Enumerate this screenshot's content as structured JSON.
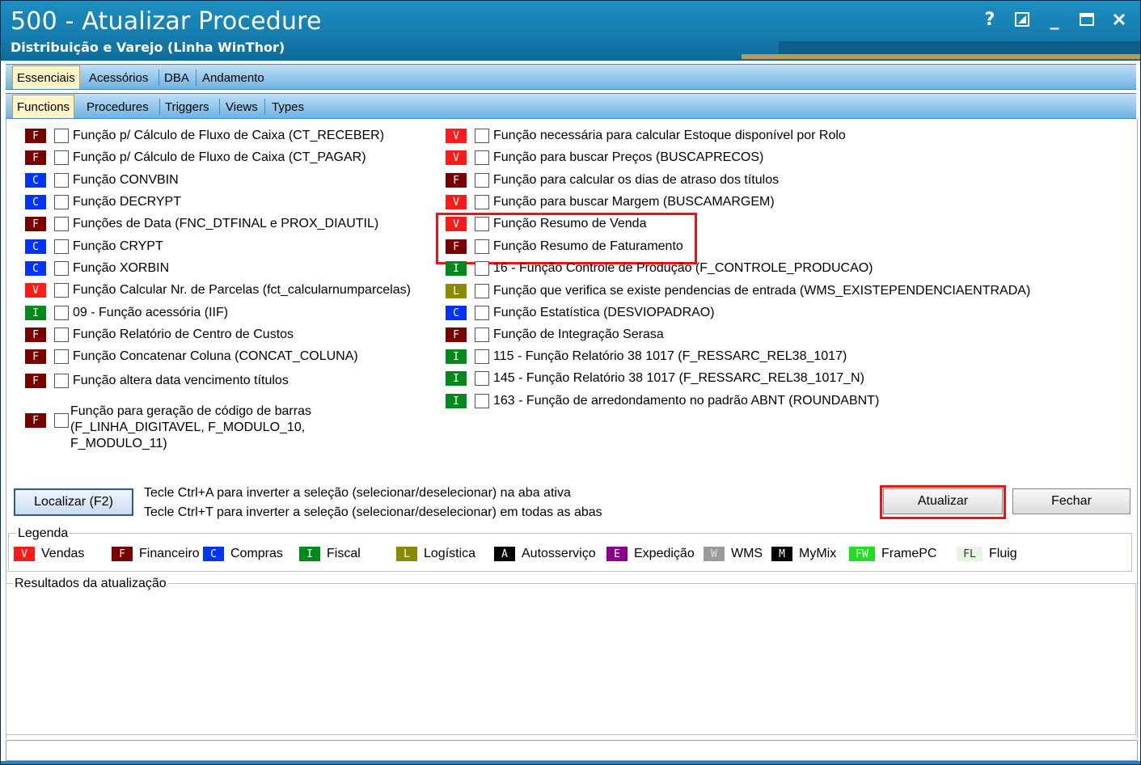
{
  "window": {
    "title": "500 - Atualizar Procedure",
    "subtitle": "Distribuição e Varejo (Linha WinThor)",
    "help_label": "?",
    "minimize_label": "_"
  },
  "tabs_main": [
    "Essenciais",
    "Acessórios",
    "DBA",
    "Andamento"
  ],
  "tabs_sub": [
    "Functions",
    "Procedures",
    "Triggers",
    "Views",
    "Types"
  ],
  "badge_colors": {
    "V": "#ff1a1a",
    "F": "#7a0000",
    "C": "#0033ff",
    "I": "#008a1c",
    "L": "#8a8a00",
    "A": "#000000",
    "E": "#8a008a",
    "W": "#9a9a9a",
    "M": "#000000",
    "FW": "#22dd22",
    "FL": "#e6f3e6"
  },
  "functions_left": [
    {
      "badge": "F",
      "label": "Função p/ Cálculo de Fluxo de Caixa (CT_RECEBER)"
    },
    {
      "badge": "F",
      "label": "Função p/ Cálculo de Fluxo de Caixa (CT_PAGAR)"
    },
    {
      "badge": "C",
      "label": "Função CONVBIN"
    },
    {
      "badge": "C",
      "label": "Função DECRYPT"
    },
    {
      "badge": "F",
      "label": "Funções de Data (FNC_DTFINAL e PROX_DIAUTIL)"
    },
    {
      "badge": "C",
      "label": "Função CRYPT"
    },
    {
      "badge": "C",
      "label": "Função XORBIN"
    },
    {
      "badge": "V",
      "label": "Função Calcular Nr. de Parcelas (fct_calcularnumparcelas)"
    },
    {
      "badge": "I",
      "label": "09 - Função acessória (IIF)"
    },
    {
      "badge": "F",
      "label": "Função Relatório de Centro de Custos"
    },
    {
      "badge": "F",
      "label": "Função Concatenar Coluna (CONCAT_COLUNA)"
    },
    {
      "badge": "F",
      "label": "Função altera data vencimento títulos"
    },
    {
      "badge": "F",
      "label": "Função para geração de código de barras (F_LINHA_DIGITAVEL, F_MODULO_10, F_MODULO_11)",
      "lines": [
        "Função para geração de código de barras",
        "(F_LINHA_DIGITAVEL, F_MODULO_10,",
        "F_MODULO_11)"
      ]
    }
  ],
  "functions_right": [
    {
      "badge": "V",
      "label": "Função necessária para calcular Estoque disponível por Rolo"
    },
    {
      "badge": "V",
      "label": "Função para buscar Preços (BUSCAPRECOS)"
    },
    {
      "badge": "F",
      "label": "Função para calcular os dias de atraso dos títulos"
    },
    {
      "badge": "V",
      "label": "Função para buscar Margem (BUSCAMARGEM)"
    },
    {
      "badge": "V",
      "label": "Função Resumo de Venda"
    },
    {
      "badge": "F",
      "label": "Função Resumo de Faturamento"
    },
    {
      "badge": "I",
      "label": "16 - Função Controle de Produção (F_CONTROLE_PRODUCAO)"
    },
    {
      "badge": "L",
      "label": "Função que verifica se existe pendencias de entrada (WMS_EXISTEPENDENCIAENTRADA)"
    },
    {
      "badge": "C",
      "label": "Função Estatística (DESVIOPADRAO)"
    },
    {
      "badge": "F",
      "label": "Função de Integração Serasa"
    },
    {
      "badge": "I",
      "label": "115 - Função Relatório 38 1017 (F_RESSARC_REL38_1017)"
    },
    {
      "badge": "I",
      "label": "145 - Função Relatório 38 1017 (F_RESSARC_REL38_1017_N)"
    },
    {
      "badge": "I",
      "label": "163 - Função de arredondamento no padrão ABNT (ROUNDABNT)"
    }
  ],
  "actions": {
    "locate_label": "Localizar (F2)",
    "update_label": "Atualizar",
    "close_label": "Fechar",
    "hint1": "Tecle Ctrl+A para inverter a seleção (selecionar/deselecionar) na aba ativa",
    "hint2": "Tecle Ctrl+T para inverter a seleção (selecionar/deselecionar) em todas as abas"
  },
  "legend": {
    "title": "Legenda",
    "items": [
      {
        "badge": "V",
        "label": "Vendas"
      },
      {
        "badge": "F",
        "label": "Financeiro"
      },
      {
        "badge": "C",
        "label": "Compras"
      },
      {
        "badge": "I",
        "label": "Fiscal"
      },
      {
        "badge": "L",
        "label": "Logística"
      },
      {
        "badge": "A",
        "label": "Autosserviço"
      },
      {
        "badge": "E",
        "label": "Expedição"
      },
      {
        "badge": "W",
        "label": "WMS"
      },
      {
        "badge": "M",
        "label": "MyMix"
      },
      {
        "badge": "FW",
        "label": "FramePC"
      },
      {
        "badge": "FL",
        "label": "Fluig"
      }
    ]
  },
  "results": {
    "title": "Resultados da atualização"
  }
}
